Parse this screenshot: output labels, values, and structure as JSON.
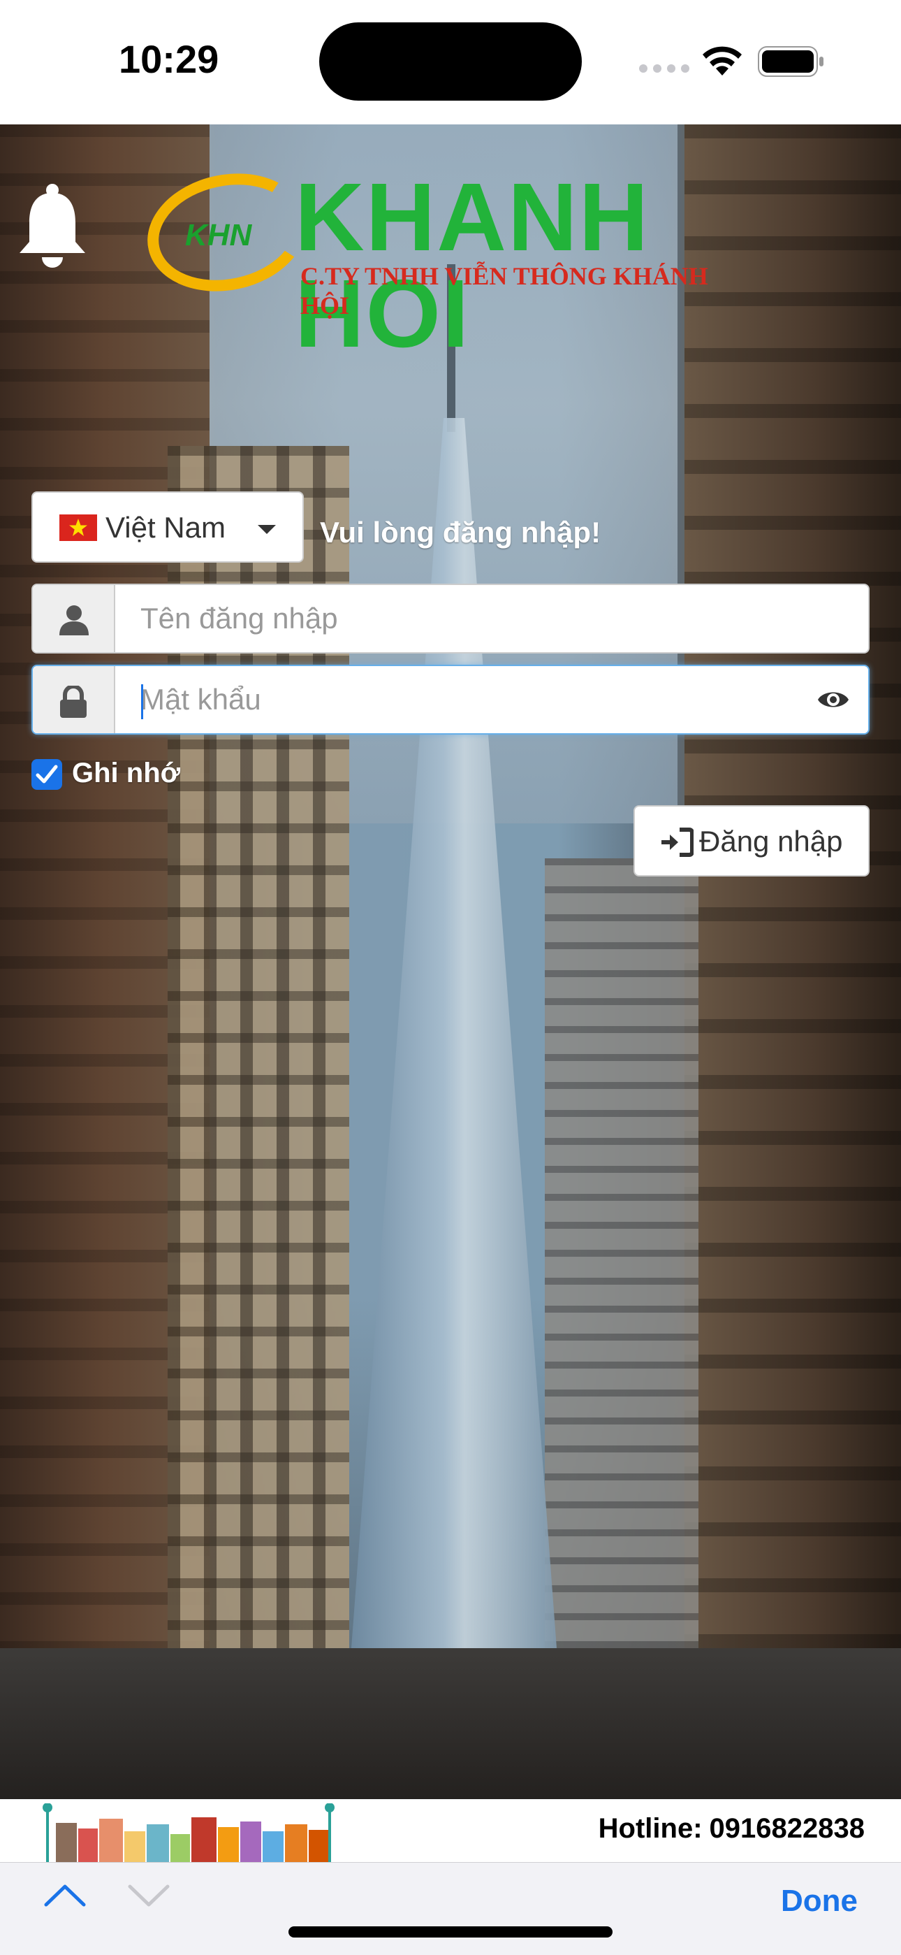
{
  "status_bar": {
    "time": "10:29"
  },
  "logo": {
    "badge": "KHN",
    "name": "KHANH HOI",
    "subtitle": "C.TY TNHH VIỄN THÔNG KHÁNH HỘI"
  },
  "language": {
    "selected": "Việt Nam",
    "flag_icon": "vietnam-flag-icon"
  },
  "login_prompt": "Vui lòng đăng nhập!",
  "form": {
    "username_placeholder": "Tên đăng nhập",
    "password_placeholder": "Mật khẩu",
    "remember_label": "Ghi nhớ",
    "remember_checked": true,
    "login_button": "Đăng nhập"
  },
  "footer": {
    "hotline_label": "Hotline:",
    "hotline_number": "0916822838"
  },
  "keyboard_toolbar": {
    "done_label": "Done"
  },
  "colors": {
    "accent": "#1a73e8",
    "logo_green": "#22b33a",
    "logo_red": "#d62a1e",
    "logo_yellow": "#f4b400"
  }
}
